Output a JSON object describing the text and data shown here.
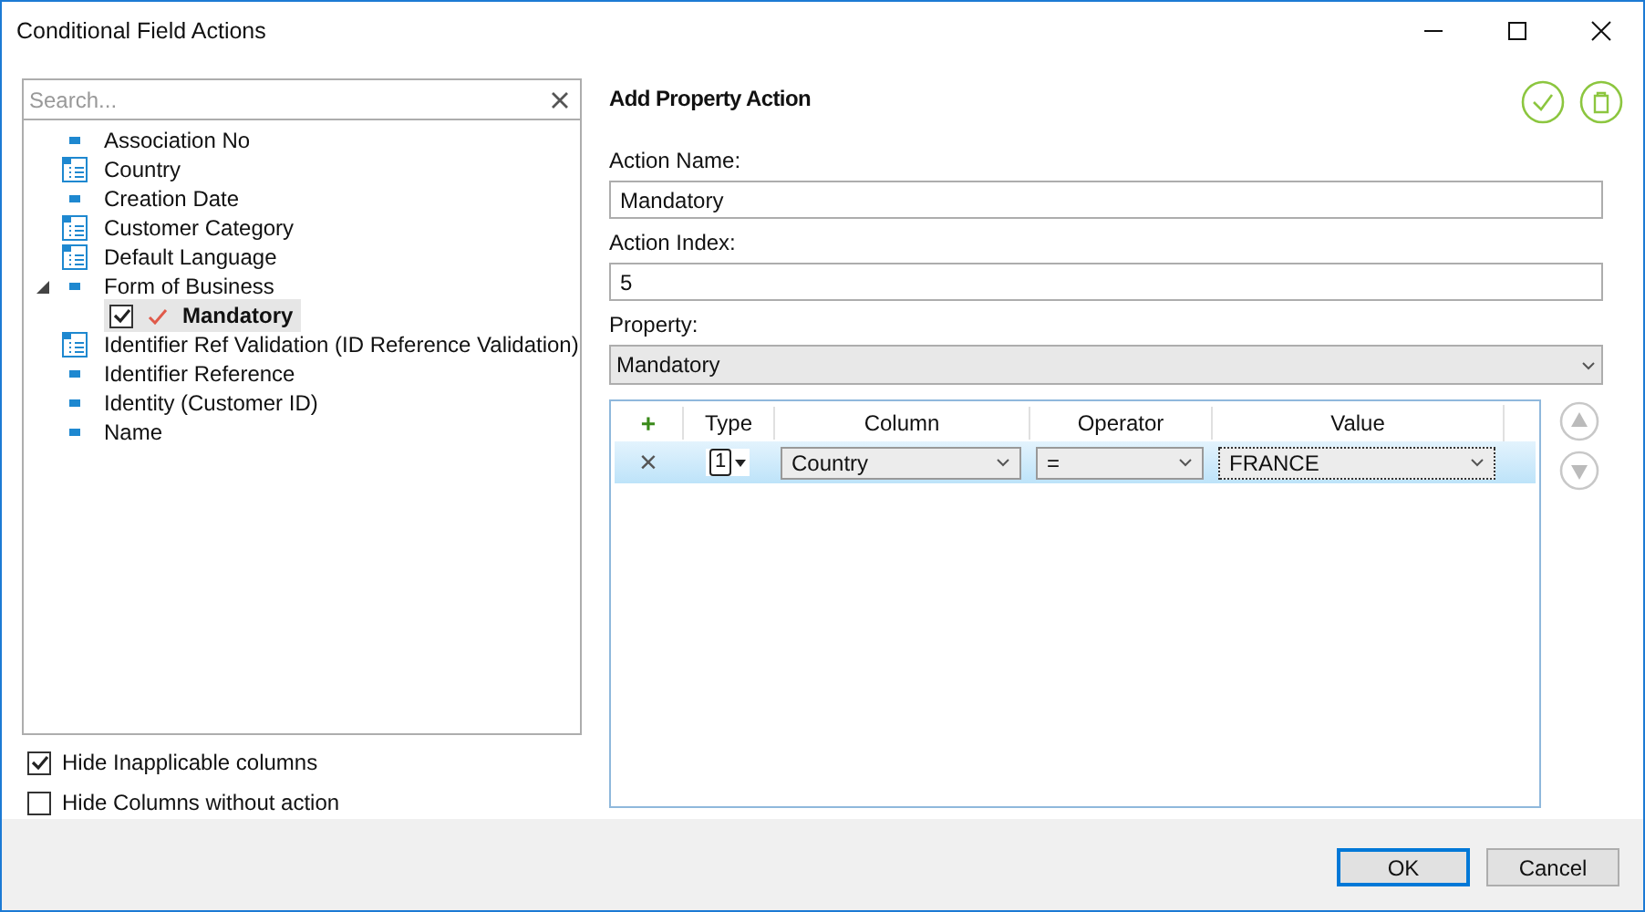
{
  "window": {
    "title": "Conditional Field Actions"
  },
  "search": {
    "placeholder": "Search..."
  },
  "tree": [
    {
      "label": "Association No",
      "kind": "field"
    },
    {
      "label": "Country",
      "kind": "list"
    },
    {
      "label": "Creation Date",
      "kind": "field"
    },
    {
      "label": "Customer Category",
      "kind": "list"
    },
    {
      "label": "Default Language",
      "kind": "list"
    },
    {
      "label": "Form of Business",
      "kind": "field",
      "expanded": true,
      "children": [
        {
          "label": "Mandatory",
          "kind": "action",
          "checked": true,
          "selected": true
        }
      ]
    },
    {
      "label": "Identifier Ref Validation (ID Reference Validation)",
      "kind": "list"
    },
    {
      "label": "Identifier Reference",
      "kind": "field"
    },
    {
      "label": "Identity (Customer ID)",
      "kind": "field"
    },
    {
      "label": "Name",
      "kind": "field"
    }
  ],
  "options": [
    {
      "label": "Hide Inapplicable columns",
      "checked": true
    },
    {
      "label": "Hide Columns without action",
      "checked": false
    }
  ],
  "form": {
    "title": "Add Property Action",
    "action_name_label": "Action Name:",
    "action_name": "Mandatory",
    "action_index_label": "Action Index:",
    "action_index": "5",
    "property_label": "Property:",
    "property": "Mandatory"
  },
  "grid": {
    "add": "+",
    "columns": [
      "Type",
      "Column",
      "Operator",
      "Value"
    ],
    "rows": [
      {
        "remove": "×",
        "type": "1",
        "column": "Country",
        "operator": "=",
        "value": "FRANCE",
        "selected": true
      }
    ]
  },
  "buttons": [
    "OK",
    "Cancel"
  ]
}
